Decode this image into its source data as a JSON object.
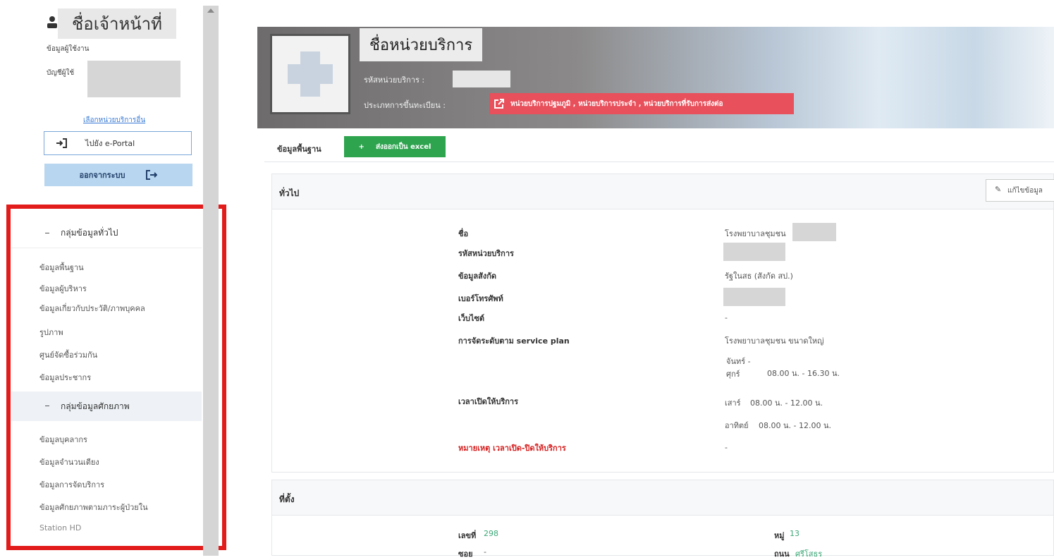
{
  "sidebar": {
    "user_title": "ชื่อเจ้าหน้าที่",
    "user_info_label": "ข้อมูลผู้ใช้งาน",
    "account_label": "บัญชีผู้ใช้",
    "switch_unit_link": "เลือกหน่วยบริการอื่น",
    "portal_button": "ไปยัง e-Portal",
    "logout_button": "ออกจากระบบ",
    "groups": [
      {
        "label": "กลุ่มข้อมูลทั่วไป",
        "items": [
          "ข้อมูลพื้นฐาน",
          "ข้อมูลผู้บริหาร",
          "ข้อมูลเกี่ยวกับประวัติ/ภาพบุคคล",
          "รูปภาพ",
          "ศูนย์จัดซื้อร่วมกัน",
          "ข้อมูลประชากร"
        ]
      },
      {
        "label": "กลุ่มข้อมูลศักยภาพ",
        "items": [
          "ข้อมูลบุคลากร",
          "ข้อมูลจำนวนเตียง",
          "ข้อมูลการจัดบริการ",
          "ข้อมูลศักยภาพตามภาระผู้ป่วยใน",
          "Station HD"
        ]
      }
    ]
  },
  "banner": {
    "unit_name": "ชื่อหน่วยบริการ",
    "unit_code_label": "รหัสหน่วยบริการ :",
    "registration_label": "ประเภทการขึ้นทะเบียน :",
    "registration_types": "หน่วยบริการปฐมภูมิ , หน่วยบริการประจำ , หน่วยบริการที่รับการส่งต่อ"
  },
  "tabs": {
    "basic_info": "ข้อมูลพื้นฐาน",
    "export_excel": "ส่งออกเป็น excel",
    "plus": "+"
  },
  "general": {
    "title": "ทั่วไป",
    "edit_button": "แก้ไขข้อมูล",
    "rows": [
      {
        "label": "ชื่อ",
        "value": "โรงพยาบาลชุมชน"
      },
      {
        "label": "รหัสหน่วยบริการ",
        "value": ""
      },
      {
        "label": "ข้อมูลสังกัด",
        "value": "รัฐในสธ (สังกัด สป.)"
      },
      {
        "label": "เบอร์โทรศัพท์",
        "value": ""
      },
      {
        "label": "เว็บไซต์",
        "value": "-"
      },
      {
        "label": "การจัดระดับตาม service plan",
        "value": "โรงพยาบาลชุมชน ขนาดใหญ่"
      }
    ],
    "hours_label": "เวลาเปิดให้บริการ",
    "hours": [
      {
        "day": "จันทร์ - ศุกร์",
        "time": "08.00 น. - 16.30 น."
      },
      {
        "day": "เสาร์",
        "time": "08.00 น. - 12.00 น."
      },
      {
        "day": "อาทิตย์",
        "time": "08.00 น. - 12.00 น."
      }
    ],
    "note_label": "หมายเหตุ เวลาเปิด-ปิดให้บริการ",
    "note_value": "-"
  },
  "location": {
    "title": "ที่ตั้ง",
    "house_no_label": "เลขที่",
    "house_no": "298",
    "moo_label": "หมู่",
    "moo": "13",
    "soi_label": "ซอย",
    "soi": "-",
    "road_label": "ถนน",
    "road": "ศรีโสธร"
  },
  "colors": {
    "red_frame": "#e21b1b",
    "excel_green": "#2ea44f",
    "badge_red": "#e8505b",
    "logout_blue": "#b8d6ef"
  }
}
